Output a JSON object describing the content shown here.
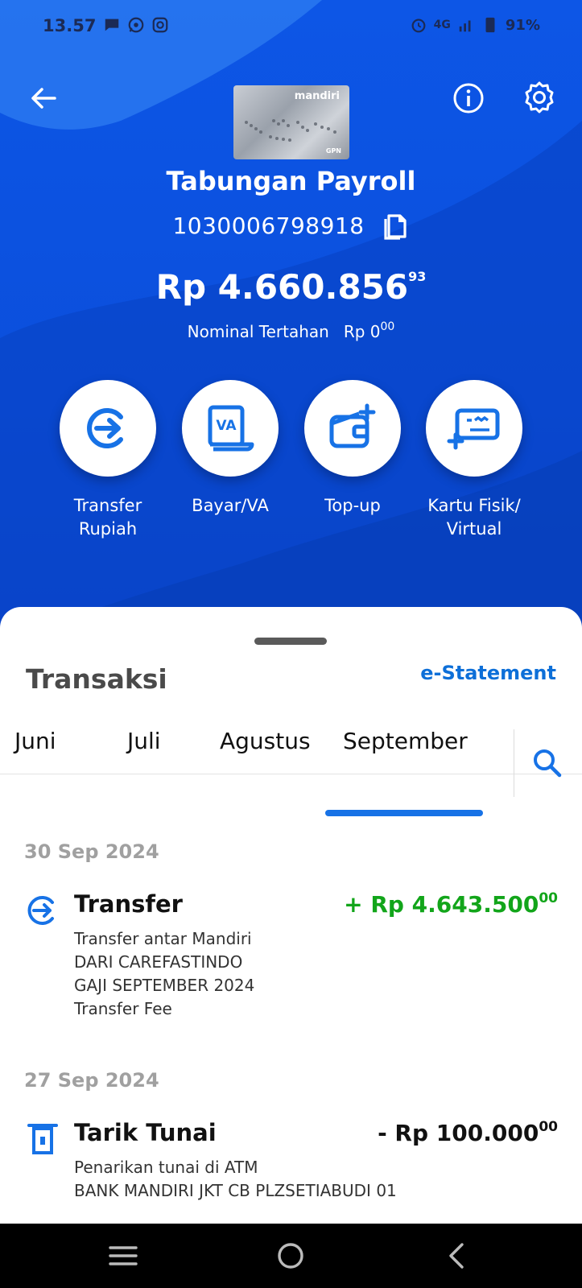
{
  "status_bar": {
    "time": "13.57",
    "battery": "91%",
    "network": "4G",
    "icons_left": [
      "chat-icon",
      "whatsapp-icon",
      "instagram-icon"
    ],
    "icons_right": [
      "alarm-icon",
      "signal-icon",
      "battery-icon"
    ]
  },
  "header": {
    "account_title": "Tabungan Payroll",
    "account_number": "1030006798918",
    "card_brand": "mandiri",
    "card_network": "GPN",
    "balance_main": "Rp 4.660.856",
    "balance_cents": "93",
    "hold_label": "Nominal Tertahan",
    "hold_amount": "Rp 0",
    "hold_cents": "00"
  },
  "actions": [
    {
      "label_line1": "Transfer",
      "label_line2": "Rupiah",
      "icon": "transfer-icon"
    },
    {
      "label_line1": "Bayar/VA",
      "label_line2": "",
      "icon": "va-icon"
    },
    {
      "label_line1": "Top-up",
      "label_line2": "",
      "icon": "wallet-add-icon"
    },
    {
      "label_line1": "Kartu Fisik/",
      "label_line2": "Virtual",
      "icon": "card-add-icon"
    }
  ],
  "sheet": {
    "title": "Transaksi",
    "estatement": "e-Statement",
    "tabs": [
      "Juni",
      "Juli",
      "Agustus",
      "September"
    ],
    "active_tab": "September"
  },
  "transactions": [
    {
      "date": "30 Sep 2024",
      "title": "Transfer",
      "amount": "+ Rp 4.643.500",
      "cents": "00",
      "lines": [
        "Transfer antar Mandiri",
        "DARI CAREFASTINDO",
        "GAJI SEPTEMBER 2024",
        "Transfer Fee"
      ],
      "amount_color": "#12a51a"
    },
    {
      "date": "27 Sep 2024",
      "title": "Tarik Tunai",
      "amount": "- Rp 100.000",
      "cents": "00",
      "lines": [
        "Penarikan tunai di ATM",
        "BANK MANDIRI JKT CB PLZSETIABUDI 01"
      ],
      "amount_color": "#111111"
    }
  ],
  "colors": {
    "brand_blue": "#0b4fdc",
    "accent_blue": "#1772e6",
    "credit_green": "#12a51a"
  }
}
